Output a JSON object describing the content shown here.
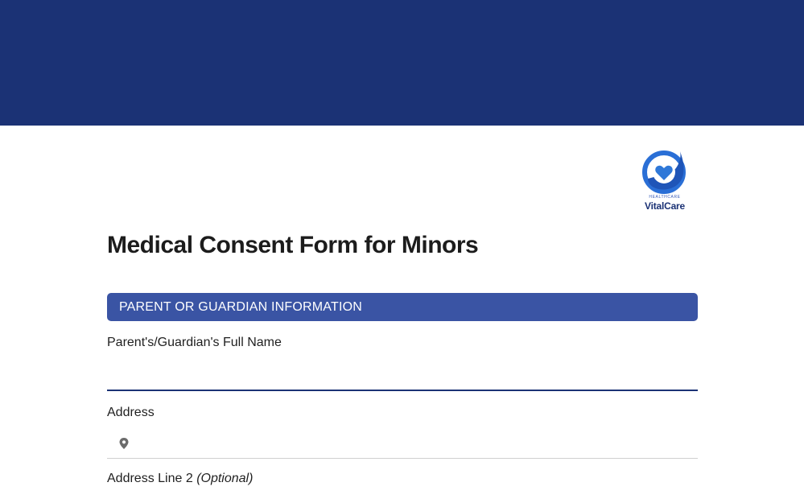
{
  "brand": {
    "tagline": "HEALTHCARE",
    "name": "VitalCare",
    "colors": {
      "navy": "#1b3275",
      "accent": "#3a54a4",
      "logo_blue": "#2a6fd6"
    }
  },
  "form": {
    "title": "Medical Consent Form for Minors",
    "section_header": "PARENT OR GUARDIAN INFORMATION",
    "fields": {
      "full_name": {
        "label": "Parent's/Guardian's Full Name",
        "value": "",
        "placeholder": ""
      },
      "address": {
        "label": "Address",
        "value": "",
        "placeholder": "",
        "icon": "location-pin-icon"
      },
      "address_line2": {
        "label": "Address Line 2",
        "optional_label": "(Optional)"
      }
    }
  }
}
